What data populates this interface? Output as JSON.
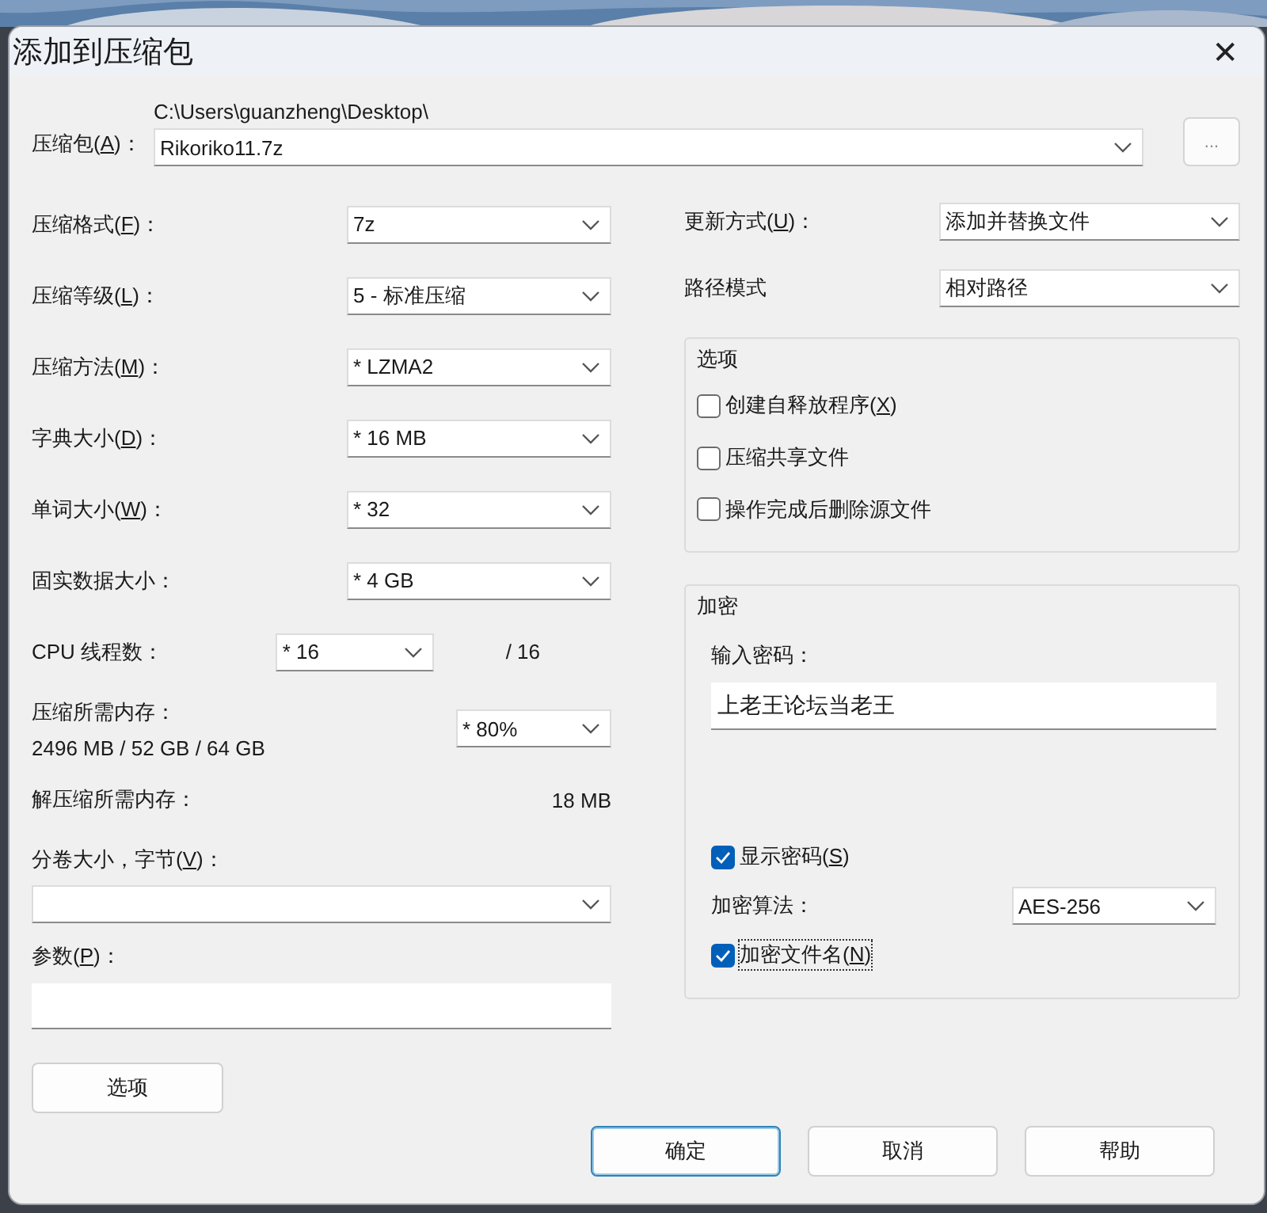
{
  "window": {
    "title": "添加到压缩包",
    "close": "✕"
  },
  "archive": {
    "label": {
      "before": "压缩包(",
      "key": "A",
      "after": ")："
    },
    "folder": "C:\\Users\\guanzheng\\Desktop\\",
    "value": "Rikoriko11.7z",
    "browse": "..."
  },
  "left_rows": [
    {
      "kind": "select",
      "label": {
        "before": "压缩格式(",
        "key": "F",
        "after": ")："
      },
      "value": "7z"
    },
    {
      "kind": "select",
      "label": {
        "before": "压缩等级(",
        "key": "L",
        "after": ")："
      },
      "value": "5 - 标准压缩"
    },
    {
      "kind": "select",
      "label": {
        "before": "压缩方法(",
        "key": "M",
        "after": ")："
      },
      "value": "*  LZMA2"
    },
    {
      "kind": "select",
      "label": {
        "before": "字典大小(",
        "key": "D",
        "after": ")："
      },
      "value": "*  16 MB"
    },
    {
      "kind": "select",
      "label": {
        "before": "单词大小(",
        "key": "W",
        "after": ")："
      },
      "value": "*  32"
    },
    {
      "kind": "select",
      "label": {
        "before": "固实数据大小："
      },
      "value": "*  4 GB"
    },
    {
      "kind": "short_select",
      "label": {
        "before": "CPU 线程数："
      },
      "value": "*  16",
      "note": "/ 16"
    },
    {
      "kind": "memory",
      "label": {
        "before": "压缩所需内存："
      },
      "detail": "2496 MB / 52 GB / 64 GB",
      "value": "*  80%"
    },
    {
      "kind": "info",
      "label": {
        "before": "解压缩所需内存："
      },
      "value": "18 MB"
    }
  ],
  "volume": {
    "label": {
      "before": "分卷大小，字节(",
      "key": "V",
      "after": ")："
    }
  },
  "params": {
    "label": {
      "before": "参数(",
      "key": "P",
      "after": ")："
    }
  },
  "options_button": "选项",
  "right_rows": [
    {
      "label": {
        "before": "更新方式(",
        "key": "U",
        "after": ")："
      },
      "value": "添加并替换文件"
    },
    {
      "label": {
        "before": "路径模式"
      },
      "value": "相对路径"
    }
  ],
  "options_group": {
    "title": "选项",
    "items": [
      {
        "label": {
          "before": "创建自释放程序(",
          "key": "X",
          "after": ")"
        },
        "checked": false
      },
      {
        "label": {
          "before": "压缩共享文件"
        },
        "checked": false
      },
      {
        "label": {
          "before": "操作完成后删除源文件"
        },
        "checked": false
      }
    ]
  },
  "encryption": {
    "title": "加密",
    "password_label": "输入密码：",
    "password": "上老王论坛当老王",
    "show_password": {
      "label": {
        "before": "显示密码(",
        "key": "S",
        "after": ")"
      },
      "checked": true
    },
    "method_label": "加密算法：",
    "method": "AES-256",
    "encrypt_names": {
      "label": {
        "before": "加密文件名(",
        "key": "N",
        "after": ")"
      },
      "checked": true,
      "focused": true
    }
  },
  "buttons": [
    {
      "label": "确定",
      "default": true
    },
    {
      "label": "取消",
      "default": false
    },
    {
      "label": "帮助",
      "default": false
    }
  ]
}
